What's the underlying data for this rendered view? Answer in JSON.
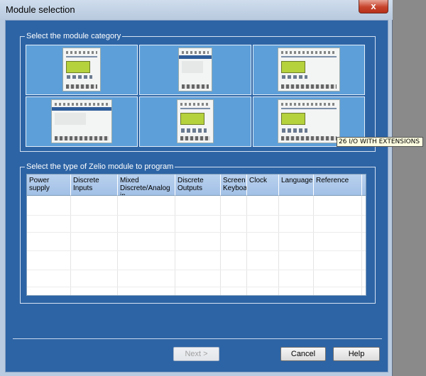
{
  "window": {
    "title": "Module selection",
    "close_label": "x"
  },
  "category_group": {
    "label": "Select the module category",
    "tooltip": "26 I/O WITH EXTENSIONS"
  },
  "type_group": {
    "label": "Select the type of Zelio module to program",
    "columns": [
      "Power supply",
      "Discrete Inputs",
      "Mixed Discrete/Analog in",
      "Discrete Outputs",
      "Screen Keyboa",
      "Clock",
      "Language",
      "Reference"
    ]
  },
  "buttons": {
    "next": "Next >",
    "cancel": "Cancel",
    "help": "Help"
  }
}
